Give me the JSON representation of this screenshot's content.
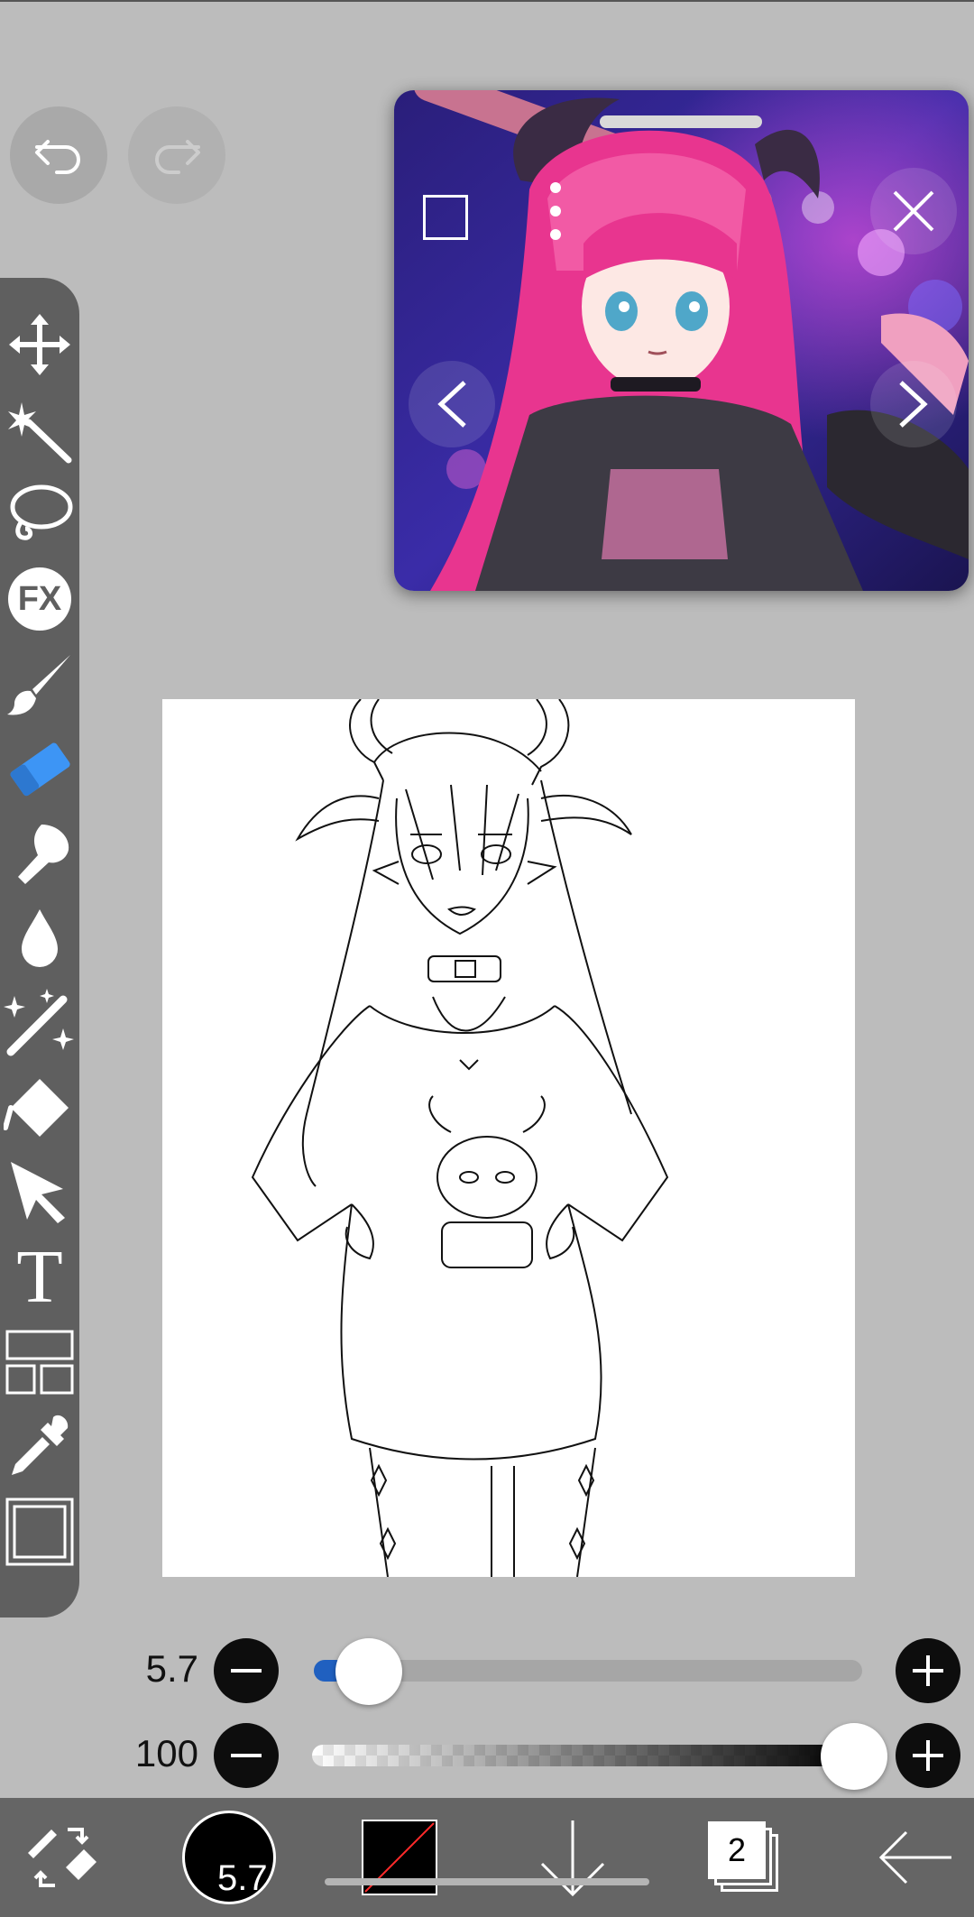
{
  "app": "ibisPaint",
  "history": {
    "undo_icon": "undo-icon",
    "redo_icon": "redo-icon",
    "redo_enabled": false
  },
  "reference_window": {
    "icons": [
      "window-mode-icon",
      "more-dots-icon",
      "close-icon",
      "prev-arrow-icon",
      "next-arrow-icon",
      "drag-handle"
    ]
  },
  "tools": [
    {
      "id": "transform",
      "icon": "move-arrows-icon"
    },
    {
      "id": "magic-wand",
      "icon": "magic-wand-icon"
    },
    {
      "id": "lasso",
      "icon": "lasso-icon"
    },
    {
      "id": "filter",
      "icon": "fx-icon",
      "label": "FX"
    },
    {
      "id": "brush",
      "icon": "brush-icon"
    },
    {
      "id": "eraser",
      "icon": "eraser-icon",
      "selected": true
    },
    {
      "id": "smudge",
      "icon": "smudge-finger-icon"
    },
    {
      "id": "blur",
      "icon": "blur-drop-icon"
    },
    {
      "id": "special-pen",
      "icon": "sparkle-pen-icon"
    },
    {
      "id": "fill",
      "icon": "bucket-icon"
    },
    {
      "id": "select",
      "icon": "cursor-arrow-icon"
    },
    {
      "id": "text",
      "icon": "text-icon",
      "label": "T"
    },
    {
      "id": "frame-divider",
      "icon": "frame-divider-icon"
    },
    {
      "id": "eyedropper",
      "icon": "eyedropper-icon"
    },
    {
      "id": "canvas",
      "icon": "canvas-icon"
    }
  ],
  "sliders": {
    "size": {
      "label": "5.7",
      "value": 5.7,
      "fraction": 0.06
    },
    "opacity": {
      "label": "100",
      "value": 100,
      "fraction": 1.0
    }
  },
  "bottom_bar": {
    "brush_size_label": "5.7",
    "layer_count": "2",
    "colors": {
      "primary": "#000000",
      "secondary_line": "#ff2a2a"
    }
  },
  "colors": {
    "toolbar_bg": "#5f5f5f",
    "accent_blue": "#3d95f5",
    "app_bg": "#bcbcbc"
  }
}
